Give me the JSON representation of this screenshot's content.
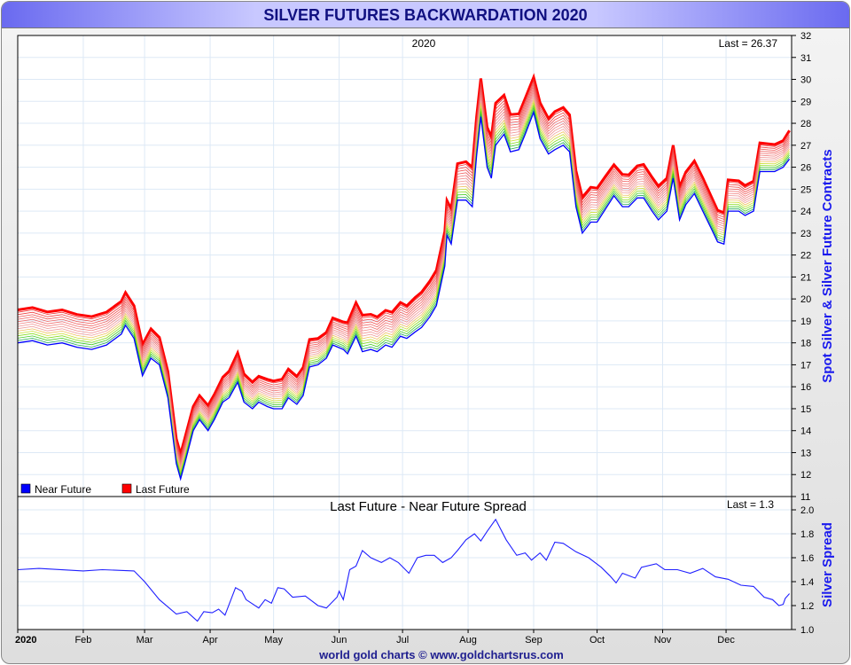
{
  "header": {
    "title": "SILVER FUTURES BACKWARDATION 2020"
  },
  "footer": {
    "credit": "world gold charts © www.goldchartsrus.com"
  },
  "chart_data": [
    {
      "type": "line",
      "title": "2020",
      "annotation": "Last = 26.37",
      "ylabel": "Spot Silver & Silver Future Contracts",
      "ylim": [
        11,
        32
      ],
      "yticks": [
        11,
        12,
        13,
        14,
        15,
        16,
        17,
        18,
        19,
        20,
        21,
        22,
        23,
        24,
        25,
        26,
        27,
        28,
        29,
        30,
        31,
        32
      ],
      "legend": [
        {
          "label": "Near Future",
          "color": "#0000ff"
        },
        {
          "label": "Last Future",
          "color": "#ff0000"
        }
      ],
      "legend_position": "bottom-left",
      "x_unit": "day of year 2020",
      "near_future": [
        [
          0,
          18.0
        ],
        [
          7,
          18.1
        ],
        [
          14,
          17.9
        ],
        [
          21,
          18.0
        ],
        [
          28,
          17.8
        ],
        [
          35,
          17.7
        ],
        [
          42,
          17.9
        ],
        [
          49,
          18.4
        ],
        [
          51,
          18.8
        ],
        [
          55,
          18.2
        ],
        [
          59,
          16.5
        ],
        [
          63,
          17.3
        ],
        [
          67,
          17.0
        ],
        [
          71,
          15.5
        ],
        [
          75,
          12.5
        ],
        [
          77,
          11.8
        ],
        [
          79,
          12.5
        ],
        [
          83,
          14.0
        ],
        [
          86,
          14.5
        ],
        [
          90,
          14.0
        ],
        [
          93,
          14.5
        ],
        [
          97,
          15.3
        ],
        [
          100,
          15.5
        ],
        [
          104,
          16.2
        ],
        [
          107,
          15.3
        ],
        [
          111,
          15.0
        ],
        [
          114,
          15.3
        ],
        [
          118,
          15.1
        ],
        [
          121,
          15.0
        ],
        [
          125,
          15.0
        ],
        [
          128,
          15.5
        ],
        [
          132,
          15.2
        ],
        [
          135,
          15.6
        ],
        [
          138,
          16.9
        ],
        [
          142,
          17.0
        ],
        [
          146,
          17.3
        ],
        [
          149,
          17.9
        ],
        [
          154,
          17.7
        ],
        [
          156,
          17.5
        ],
        [
          160,
          18.3
        ],
        [
          163,
          17.6
        ],
        [
          167,
          17.7
        ],
        [
          170,
          17.6
        ],
        [
          174,
          17.9
        ],
        [
          177,
          17.8
        ],
        [
          181,
          18.3
        ],
        [
          184,
          18.2
        ],
        [
          188,
          18.5
        ],
        [
          191,
          18.7
        ],
        [
          195,
          19.2
        ],
        [
          198,
          19.7
        ],
        [
          202,
          21.5
        ],
        [
          203,
          22.9
        ],
        [
          205,
          22.5
        ],
        [
          208,
          24.5
        ],
        [
          212,
          24.5
        ],
        [
          215,
          24.2
        ],
        [
          217,
          26.5
        ],
        [
          219,
          28.3
        ],
        [
          222,
          26.0
        ],
        [
          224,
          25.5
        ],
        [
          226,
          27.0
        ],
        [
          230,
          27.5
        ],
        [
          233,
          26.7
        ],
        [
          237,
          26.8
        ],
        [
          240,
          27.5
        ],
        [
          244,
          28.5
        ],
        [
          247,
          27.3
        ],
        [
          251,
          26.6
        ],
        [
          254,
          26.8
        ],
        [
          258,
          27.0
        ],
        [
          261,
          26.7
        ],
        [
          264,
          24.2
        ],
        [
          267,
          23.0
        ],
        [
          271,
          23.5
        ],
        [
          274,
          23.5
        ],
        [
          278,
          24.1
        ],
        [
          282,
          24.7
        ],
        [
          286,
          24.2
        ],
        [
          289,
          24.2
        ],
        [
          293,
          24.6
        ],
        [
          296,
          24.6
        ],
        [
          300,
          24.0
        ],
        [
          303,
          23.6
        ],
        [
          307,
          24.0
        ],
        [
          310,
          25.5
        ],
        [
          313,
          23.6
        ],
        [
          316,
          24.3
        ],
        [
          320,
          24.8
        ],
        [
          324,
          24.0
        ],
        [
          328,
          23.2
        ],
        [
          331,
          22.6
        ],
        [
          334,
          22.5
        ],
        [
          336,
          24.0
        ],
        [
          341,
          24.0
        ],
        [
          344,
          23.8
        ],
        [
          348,
          24.0
        ],
        [
          351,
          25.8
        ],
        [
          355,
          25.8
        ],
        [
          358,
          25.8
        ],
        [
          362,
          26.0
        ],
        [
          365,
          26.37
        ]
      ]
    },
    {
      "type": "line",
      "title": "Last Future - Near Future Spread",
      "annotation": "Last = 1.3",
      "ylabel": "Silver Spread",
      "ylim": [
        1.0,
        2.0
      ],
      "yticks": [
        "1.0",
        "1.2",
        "1.4",
        "1.6",
        "1.8",
        "2.0"
      ],
      "xticks": [
        "2020",
        "Feb",
        "Mar",
        "Apr",
        "May",
        "Jun",
        "Jul",
        "Aug",
        "Sep",
        "Oct",
        "Nov",
        "Dec"
      ],
      "xtick_days": [
        0,
        31,
        60,
        91,
        121,
        152,
        182,
        213,
        244,
        274,
        305,
        335
      ],
      "spread": [
        [
          0,
          1.5
        ],
        [
          10,
          1.51
        ],
        [
          31,
          1.49
        ],
        [
          40,
          1.5
        ],
        [
          55,
          1.49
        ],
        [
          60,
          1.4
        ],
        [
          67,
          1.25
        ],
        [
          75,
          1.13
        ],
        [
          80,
          1.15
        ],
        [
          85,
          1.07
        ],
        [
          88,
          1.15
        ],
        [
          92,
          1.14
        ],
        [
          95,
          1.17
        ],
        [
          98,
          1.12
        ],
        [
          103,
          1.35
        ],
        [
          106,
          1.32
        ],
        [
          108,
          1.25
        ],
        [
          114,
          1.18
        ],
        [
          117,
          1.25
        ],
        [
          120,
          1.22
        ],
        [
          123,
          1.35
        ],
        [
          126,
          1.34
        ],
        [
          130,
          1.27
        ],
        [
          136,
          1.28
        ],
        [
          142,
          1.2
        ],
        [
          146,
          1.18
        ],
        [
          151,
          1.27
        ],
        [
          152,
          1.32
        ],
        [
          154,
          1.25
        ],
        [
          157,
          1.5
        ],
        [
          160,
          1.53
        ],
        [
          163,
          1.66
        ],
        [
          167,
          1.6
        ],
        [
          172,
          1.56
        ],
        [
          176,
          1.6
        ],
        [
          180,
          1.56
        ],
        [
          185,
          1.47
        ],
        [
          189,
          1.6
        ],
        [
          193,
          1.62
        ],
        [
          197,
          1.62
        ],
        [
          201,
          1.56
        ],
        [
          205,
          1.6
        ],
        [
          208,
          1.66
        ],
        [
          212,
          1.75
        ],
        [
          216,
          1.8
        ],
        [
          219,
          1.74
        ],
        [
          222,
          1.82
        ],
        [
          226,
          1.92
        ],
        [
          231,
          1.75
        ],
        [
          236,
          1.62
        ],
        [
          240,
          1.64
        ],
        [
          243,
          1.58
        ],
        [
          247,
          1.64
        ],
        [
          250,
          1.58
        ],
        [
          254,
          1.73
        ],
        [
          258,
          1.72
        ],
        [
          264,
          1.65
        ],
        [
          270,
          1.6
        ],
        [
          276,
          1.52
        ],
        [
          280,
          1.45
        ],
        [
          283,
          1.39
        ],
        [
          286,
          1.47
        ],
        [
          292,
          1.43
        ],
        [
          295,
          1.52
        ],
        [
          302,
          1.55
        ],
        [
          306,
          1.5
        ],
        [
          312,
          1.5
        ],
        [
          318,
          1.47
        ],
        [
          324,
          1.51
        ],
        [
          330,
          1.44
        ],
        [
          336,
          1.42
        ],
        [
          342,
          1.37
        ],
        [
          348,
          1.36
        ],
        [
          353,
          1.27
        ],
        [
          357,
          1.25
        ],
        [
          360,
          1.2
        ],
        [
          362,
          1.21
        ],
        [
          363,
          1.26
        ],
        [
          365,
          1.3
        ]
      ]
    }
  ]
}
